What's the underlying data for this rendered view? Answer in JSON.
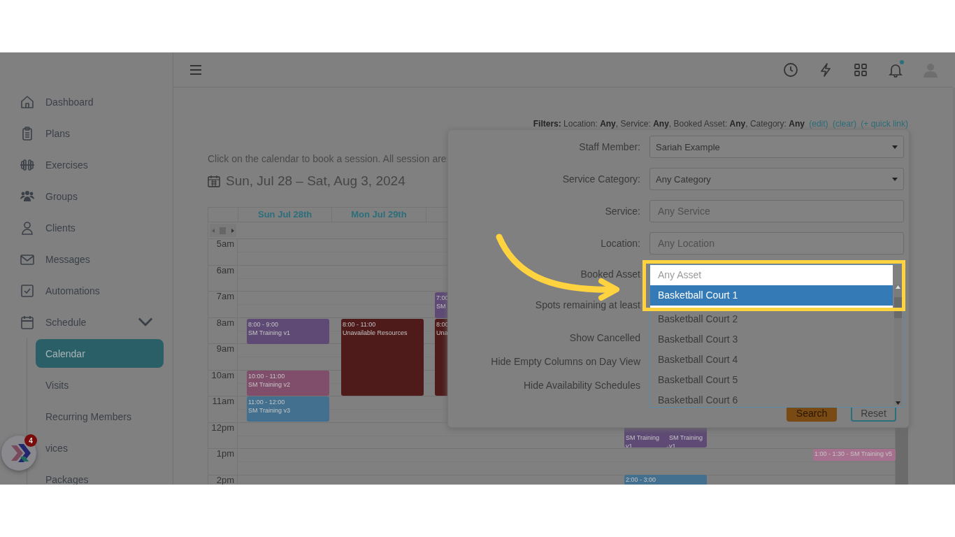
{
  "sidebar": {
    "items": [
      {
        "label": "Dashboard",
        "selected": false
      },
      {
        "label": "Plans",
        "selected": false
      },
      {
        "label": "Exercises",
        "selected": false
      },
      {
        "label": "Groups",
        "selected": false
      },
      {
        "label": "Clients",
        "selected": false
      },
      {
        "label": "Messages",
        "selected": false
      },
      {
        "label": "Automations",
        "selected": false
      },
      {
        "label": "Schedule",
        "selected": false,
        "expanded": true,
        "children": [
          {
            "label": "Calendar",
            "selected": true
          },
          {
            "label": "Visits",
            "selected": false
          },
          {
            "label": "Recurring Members",
            "selected": false
          },
          {
            "label": "vices",
            "selected": false
          },
          {
            "label": "Packages",
            "selected": false
          }
        ]
      }
    ]
  },
  "launcher": {
    "badge": "4"
  },
  "topbar": {
    "has_unread": true
  },
  "filters": {
    "summary": "**Filters:** Location: **Any**, Service: **Any**, Booked Asset: **Any**, Category: **Any**",
    "links": [
      "(edit)",
      "(clear)",
      "(+ quick link)"
    ]
  },
  "calendar": {
    "instructions": "Click on the calendar to book a session. All session are",
    "range": "Sun, Jul 28 – Sat, Aug 3, 2024",
    "days": [
      "Sun Jul 28th",
      "Mon Jul 29th"
    ],
    "hours": [
      "5am",
      "6am",
      "7am",
      "8am",
      "9am",
      "10am",
      "11am",
      "12pm",
      "1pm",
      "2pm"
    ],
    "events": [
      {
        "lines": [
          "8:00 - 9:00",
          "SM Training v1"
        ],
        "color": "#5e4a74"
      },
      {
        "lines": [
          "10:00 - 11:00",
          "SM Training v2"
        ],
        "color": "#804d6b"
      },
      {
        "lines": [
          "11:00 - 12:00",
          "SM Training v3"
        ],
        "color": "#43708f"
      },
      {
        "lines": [
          "8:00 - 11:00",
          "Unavailable Resources"
        ],
        "color": "#4e1a1a"
      },
      {
        "lines": [
          "7:00",
          "SM"
        ],
        "color": "#5e4a74"
      },
      {
        "lines": [
          "8:00",
          "Una"
        ],
        "color": "#4e1a1a"
      },
      {
        "lines": [
          "SM Training v1"
        ],
        "color": "#5e4a74"
      },
      {
        "lines": [
          "SM Training v1"
        ],
        "color": "#5e4a74"
      },
      {
        "lines": [
          "1:00 - 1:30 - SM Training v5"
        ],
        "color": "#a8708f"
      },
      {
        "lines": [
          "2:00 - 3:00"
        ],
        "color": "#43708f"
      }
    ]
  },
  "filter_panel": {
    "fields": [
      {
        "label": "Staff Member:",
        "kind": "select",
        "value": "Sariah Example"
      },
      {
        "label": "Service Category:",
        "kind": "select",
        "value": "Any Category"
      },
      {
        "label": "Service:",
        "kind": "input",
        "placeholder": "Any Service"
      },
      {
        "label": "Location:",
        "kind": "input",
        "placeholder": "Any Location"
      },
      {
        "label": "Booked Asset",
        "kind": "listbox"
      },
      {
        "label": "Spots remaining at least",
        "kind": "number"
      },
      {
        "label": "Show Cancelled",
        "kind": "checkbox"
      },
      {
        "label": "Hide Empty Columns on Day View",
        "kind": "checkbox"
      },
      {
        "label": "Hide Availability Schedules",
        "kind": "checkbox"
      }
    ],
    "asset_options": [
      {
        "label": "Any Asset",
        "kind": "hint",
        "selected": false
      },
      {
        "label": "Basketball Court 1",
        "kind": "option",
        "selected": true
      },
      {
        "label": "Basketball Court 2",
        "kind": "option",
        "selected": false
      },
      {
        "label": "Basketball Court 3",
        "kind": "option",
        "selected": false
      },
      {
        "label": "Basketball Court 4",
        "kind": "option",
        "selected": false
      },
      {
        "label": "Basketball Court 5",
        "kind": "option",
        "selected": false
      },
      {
        "label": "Basketball Court 6",
        "kind": "option",
        "selected": false
      }
    ],
    "buttons": [
      {
        "label": "Search",
        "kind": "primary"
      },
      {
        "label": "Reset",
        "kind": "secondary"
      }
    ]
  }
}
